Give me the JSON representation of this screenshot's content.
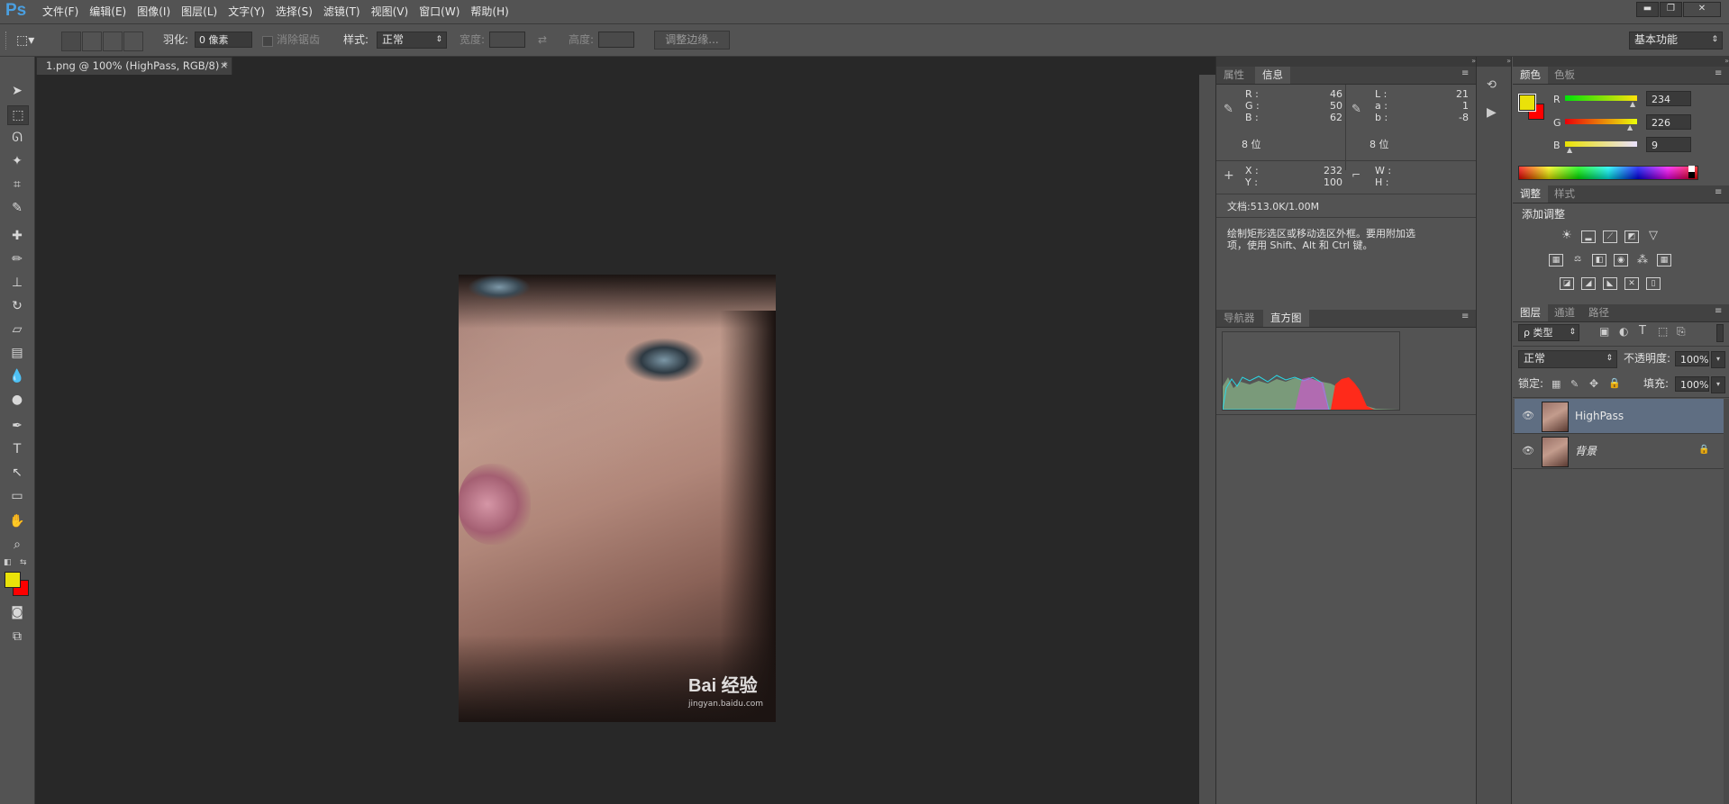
{
  "app": {
    "logo": "Ps"
  },
  "menu": [
    "文件(F)",
    "编辑(E)",
    "图像(I)",
    "图层(L)",
    "文字(Y)",
    "选择(S)",
    "滤镜(T)",
    "视图(V)",
    "窗口(W)",
    "帮助(H)"
  ],
  "window_controls": {
    "minimize": "▬",
    "restore": "❐",
    "close": "✕"
  },
  "options": {
    "feather_label": "羽化:",
    "feather_value": "0 像素",
    "antialias_label": "消除锯齿",
    "style_label": "样式:",
    "style_value": "正常",
    "width_label": "宽度:",
    "height_label": "高度:",
    "refine_edge": "调整边缘...",
    "workspace": "基本功能"
  },
  "document": {
    "tab_title": "1.png @ 100% (HighPass, RGB/8) *",
    "close": "×",
    "watermark": "Bai 经验",
    "watermark_url": "jingyan.baidu.com"
  },
  "info_panel": {
    "tabs": [
      "属性",
      "信息"
    ],
    "r_label": "R :",
    "g_label": "G :",
    "b_label": "B :",
    "r": "46",
    "g": "50",
    "b": "62",
    "l_label": "L :",
    "a_label": "a :",
    "lab_b_label": "b :",
    "l": "21",
    "a": "1",
    "lab_b": "-8",
    "bits_left": "8 位",
    "bits_right": "8 位",
    "x_label": "X :",
    "y_label": "Y :",
    "x": "232",
    "y": "100",
    "w_label": "W :",
    "h_label": "H :",
    "doc_size": "文档:513.0K/1.00M",
    "hint_line1": "绘制矩形选区或移动选区外框。要用附加选",
    "hint_line2": "项，使用 Shift、Alt 和 Ctrl 键。"
  },
  "nav_panel": {
    "tabs": [
      "导航器",
      "直方图"
    ]
  },
  "color_panel": {
    "tabs": [
      "颜色",
      "色板"
    ],
    "r_label": "R",
    "g_label": "G",
    "b_label": "B",
    "r": "234",
    "g": "226",
    "b": "9",
    "foreground": "#eae209",
    "background": "#ff0000"
  },
  "adjust_panel": {
    "tabs": [
      "调整",
      "样式"
    ],
    "add_label": "添加调整"
  },
  "layers_panel": {
    "tabs": [
      "图层",
      "通道",
      "路径"
    ],
    "filter_label": "ρ 类型",
    "blend_mode": "正常",
    "opacity_label": "不透明度:",
    "opacity": "100%",
    "lock_label": "锁定:",
    "fill_label": "填充:",
    "fill": "100%",
    "layers": [
      {
        "name": "HighPass",
        "selected": true
      },
      {
        "name": "背景",
        "selected": false,
        "locked": true
      }
    ]
  },
  "toolbar_icons": [
    "move-icon",
    "marquee-icon",
    "lasso-icon",
    "magic-wand-icon",
    "crop-icon",
    "eyedropper-icon",
    "healing-brush-icon",
    "brush-icon",
    "clone-stamp-icon",
    "history-brush-icon",
    "eraser-icon",
    "gradient-icon",
    "blur-icon",
    "dodge-icon",
    "pen-icon",
    "type-icon",
    "path-selection-icon",
    "shape-icon",
    "hand-icon",
    "zoom-icon"
  ]
}
